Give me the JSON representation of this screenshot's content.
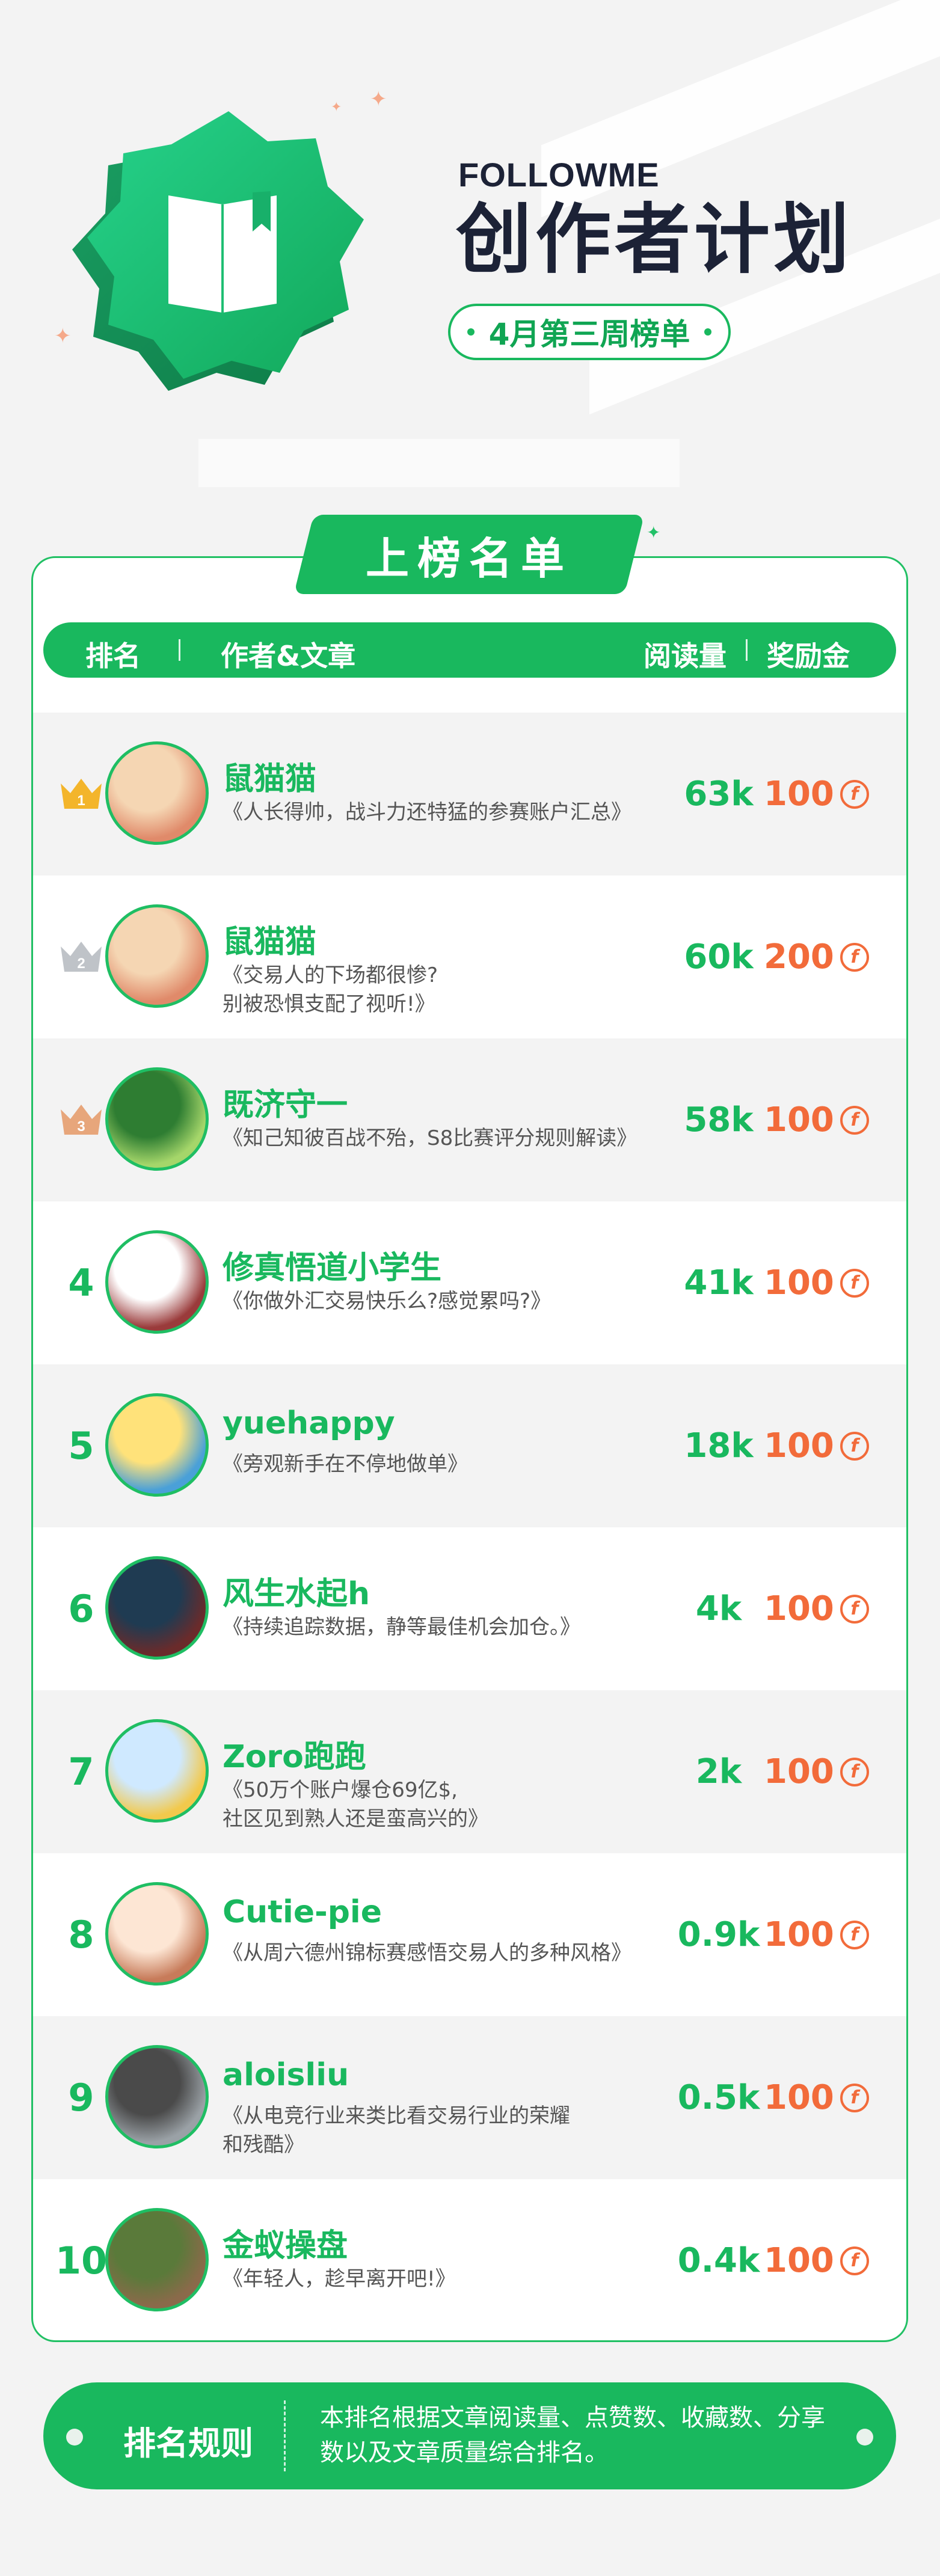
{
  "header": {
    "brand": "FOLLOWME",
    "title": "创作者计划",
    "week_label": "4月第三周榜单"
  },
  "board": {
    "tab_label": "上榜名单",
    "columns": {
      "rank": "排名",
      "author_article": "作者&文章",
      "reads": "阅读量",
      "bonus": "奖励金"
    }
  },
  "rows": [
    {
      "rank": "1",
      "author": "鼠猫猫",
      "article": "《人长得帅，战斗力还特猛的参赛账户汇总》",
      "reads": "63k",
      "bonus": "100",
      "crown": "gold"
    },
    {
      "rank": "2",
      "author": "鼠猫猫",
      "article": "《交易人的下场都很惨?\n别被恐惧支配了视听!》",
      "reads": "60k",
      "bonus": "200",
      "crown": "silver"
    },
    {
      "rank": "3",
      "author": "既济守一",
      "article": "《知己知彼百战不殆，S8比赛评分规则解读》",
      "reads": "58k",
      "bonus": "100",
      "crown": "bronze"
    },
    {
      "rank": "4",
      "author": "修真悟道小学生",
      "article": "《你做外汇交易快乐么?感觉累吗?》",
      "reads": "41k",
      "bonus": "100"
    },
    {
      "rank": "5",
      "author": "yuehappy",
      "article": "《旁观新手在不停地做单》",
      "reads": "18k",
      "bonus": "100"
    },
    {
      "rank": "6",
      "author": "风生水起h",
      "article": "《持续追踪数据，静等最佳机会加仓。》",
      "reads": "4k",
      "bonus": "100"
    },
    {
      "rank": "7",
      "author": "Zoro跑跑",
      "article": "《50万个账户爆仓69亿$,\n社区见到熟人还是蛮高兴的》",
      "reads": "2k",
      "bonus": "100"
    },
    {
      "rank": "8",
      "author": "Cutie-pie",
      "article": "《从周六德州锦标赛感悟交易人的多种风格》",
      "reads": "0.9k",
      "bonus": "100"
    },
    {
      "rank": "9",
      "author": "aloisliu",
      "article": "《从电竞行业来类比看交易行业的荣耀\n和残酷》",
      "reads": "0.5k",
      "bonus": "100"
    },
    {
      "rank": "10",
      "author": "金蚁操盘",
      "article": "《年轻人，趁早离开吧!》",
      "reads": "0.4k",
      "bonus": "100"
    }
  ],
  "footer": {
    "rules_title": "排名规则",
    "rules_text": "本排名根据文章阅读量、点赞数、收藏数、分享数以及文章质量综合排名。"
  },
  "icons": {
    "badge": "open-book-icon",
    "coin": "f-coin-icon",
    "crown": "crown-icon"
  },
  "colors": {
    "brand_green": "#19b85e",
    "bonus_orange": "#f26b3a",
    "title_navy": "#1c2236",
    "gold": "#f3b52b",
    "silver": "#bfc3c8",
    "bronze": "#e7a67b"
  }
}
